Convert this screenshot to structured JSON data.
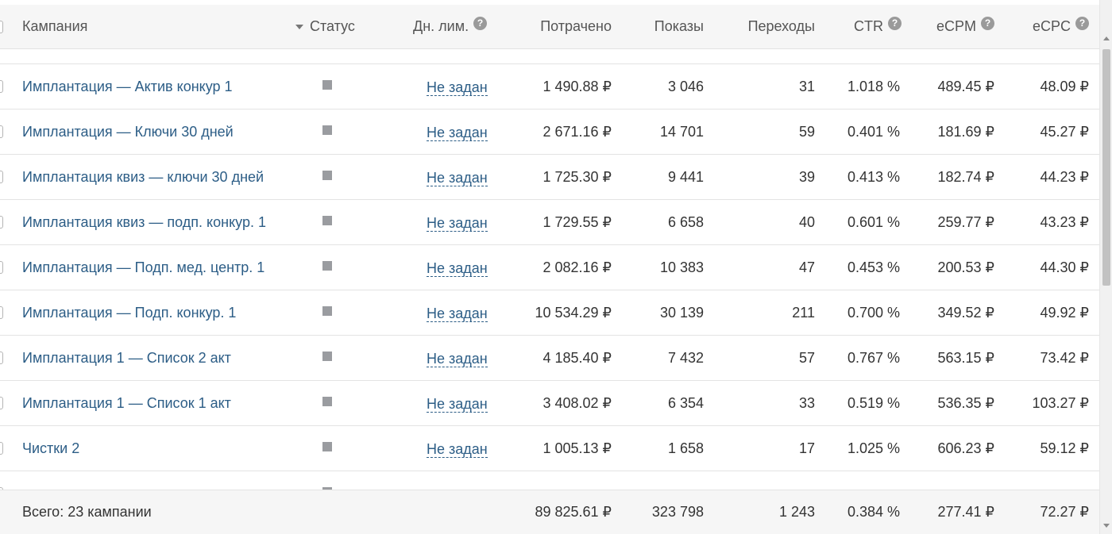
{
  "header": {
    "campaign": "Кампания",
    "status": "Статус",
    "daily_limit": "Дн. лим.",
    "spent": "Потрачено",
    "shows": "Показы",
    "clicks": "Переходы",
    "ctr": "CTR",
    "ecpm": "eCPM",
    "ecpc": "eCPC",
    "help_symbol": "?"
  },
  "rows": [
    {
      "name": "",
      "limit": "",
      "spent": "",
      "shows": "",
      "clicks": "",
      "ctr": "",
      "ecpm": "",
      "ecpc": ""
    },
    {
      "name": "Имплантация — Актив конкур 1",
      "limit": "Не задан",
      "spent": "1 490.88 ₽",
      "shows": "3 046",
      "clicks": "31",
      "ctr": "1.018 %",
      "ecpm": "489.45 ₽",
      "ecpc": "48.09 ₽"
    },
    {
      "name": "Имплантация — Ключи 30 дней",
      "limit": "Не задан",
      "spent": "2 671.16 ₽",
      "shows": "14 701",
      "clicks": "59",
      "ctr": "0.401 %",
      "ecpm": "181.69 ₽",
      "ecpc": "45.27 ₽"
    },
    {
      "name": "Имплантация квиз — ключи 30 дней",
      "limit": "Не задан",
      "spent": "1 725.30 ₽",
      "shows": "9 441",
      "clicks": "39",
      "ctr": "0.413 %",
      "ecpm": "182.74 ₽",
      "ecpc": "44.23 ₽"
    },
    {
      "name": "Имплантация квиз — подп. конкур. 1",
      "limit": "Не задан",
      "spent": "1 729.55 ₽",
      "shows": "6 658",
      "clicks": "40",
      "ctr": "0.601 %",
      "ecpm": "259.77 ₽",
      "ecpc": "43.23 ₽"
    },
    {
      "name": "Имплантация — Подп. мед. центр. 1",
      "limit": "Не задан",
      "spent": "2 082.16 ₽",
      "shows": "10 383",
      "clicks": "47",
      "ctr": "0.453 %",
      "ecpm": "200.53 ₽",
      "ecpc": "44.30 ₽"
    },
    {
      "name": "Имплантация — Подп. конкур. 1",
      "limit": "Не задан",
      "spent": "10 534.29 ₽",
      "shows": "30 139",
      "clicks": "211",
      "ctr": "0.700 %",
      "ecpm": "349.52 ₽",
      "ecpc": "49.92 ₽"
    },
    {
      "name": "Имплантация 1 — Список 2 акт",
      "limit": "Не задан",
      "spent": "4 185.40 ₽",
      "shows": "7 432",
      "clicks": "57",
      "ctr": "0.767 %",
      "ecpm": "563.15 ₽",
      "ecpc": "73.42 ₽"
    },
    {
      "name": "Имплантация 1 — Список 1 акт",
      "limit": "Не задан",
      "spent": "3 408.02 ₽",
      "shows": "6 354",
      "clicks": "33",
      "ctr": "0.519 %",
      "ecpm": "536.35 ₽",
      "ecpc": "103.27 ₽"
    },
    {
      "name": "Чистки 2",
      "limit": "Не задан",
      "spent": "1 005.13 ₽",
      "shows": "1 658",
      "clicks": "17",
      "ctr": "1.025 %",
      "ecpm": "606.23 ₽",
      "ecpc": "59.12 ₽"
    },
    {
      "name": "",
      "limit": "",
      "spent": "",
      "shows": "",
      "clicks": "",
      "ctr": "",
      "ecpm": "",
      "ecpc": ""
    }
  ],
  "footer": {
    "total_label": "Всего: 23 кампании",
    "spent": "89 825.61 ₽",
    "shows": "323 798",
    "clicks": "1 243",
    "ctr": "0.384 %",
    "ecpm": "277.41 ₽",
    "ecpc": "72.27 ₽"
  },
  "colors": {
    "link": "#2c5d86",
    "header_bg": "#f6f6f6",
    "status_paused": "#9a9ca0"
  },
  "icons": {
    "status": "stop-square-icon",
    "sort": "sort-down-icon",
    "help": "question-circle-icon"
  }
}
